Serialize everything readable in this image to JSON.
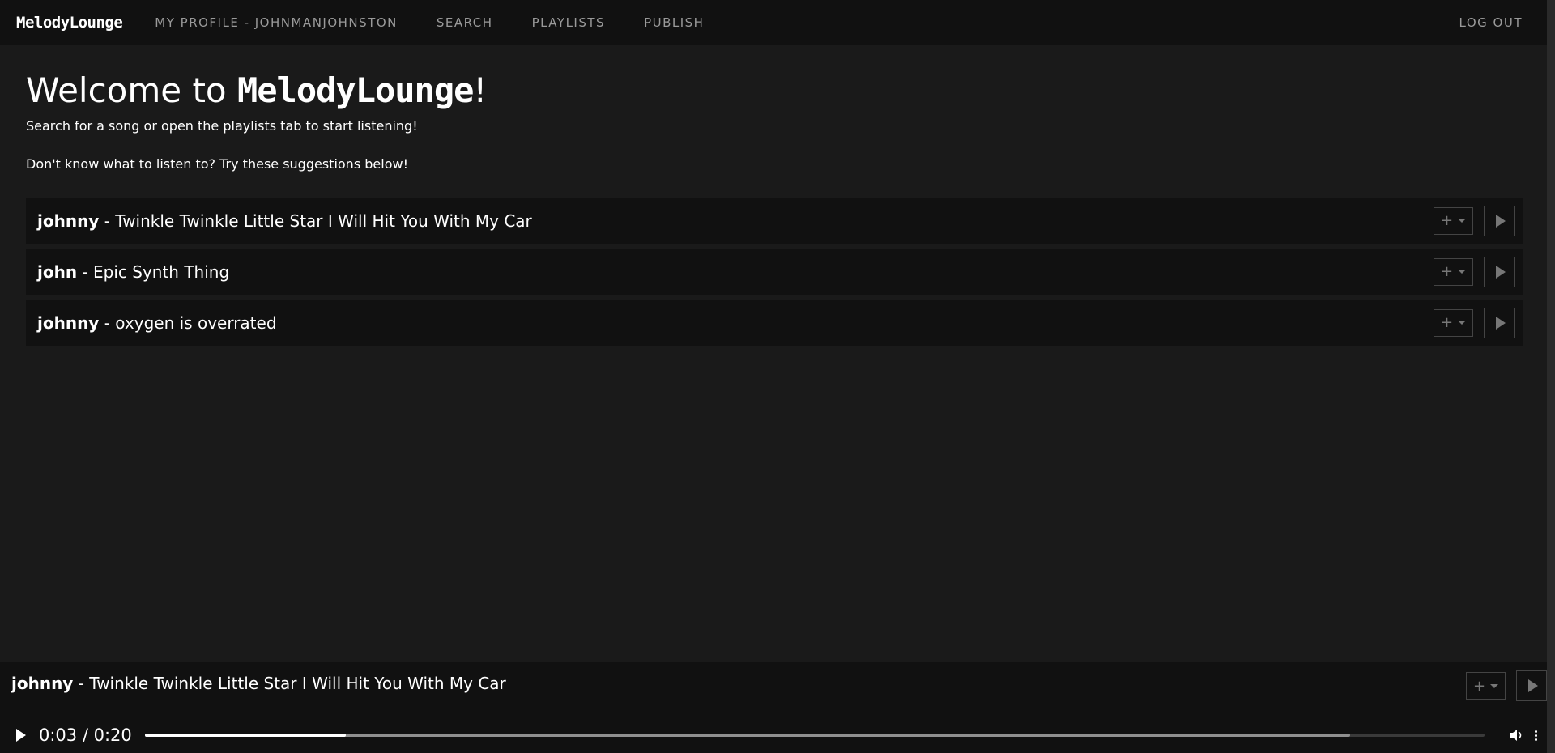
{
  "nav": {
    "brand": "MelodyLounge",
    "profile": "My Profile - johnmanjohnston",
    "search": "Search",
    "playlists": "Playlists",
    "publish": "Publish",
    "logout": "Log Out"
  },
  "main": {
    "welcome_prefix": "Welcome to ",
    "welcome_brand": "MelodyLounge",
    "welcome_suffix": "!",
    "subtitle": "Search for a song or open the playlists tab to start listening!",
    "suggestion_prompt": "Don't know what to listen to? Try these suggestions below!"
  },
  "songs": [
    {
      "artist": "johnny",
      "title": "Twinkle Twinkle Little Star I Will Hit You With My Car"
    },
    {
      "artist": "john",
      "title": "Epic Synth Thing"
    },
    {
      "artist": "johnny",
      "title": "oxygen is overrated"
    }
  ],
  "player": {
    "artist": "johnny",
    "title": "Twinkle Twinkle Little Star I Will Hit You With My Car",
    "current_time": "0:03",
    "duration": "0:20",
    "time_display": "0:03 / 0:20",
    "progress": 0.15,
    "buffered": 0.9
  },
  "icons": {
    "add": "plus-icon",
    "dropdown": "caret-down-icon",
    "play": "play-icon",
    "volume": "volume-icon",
    "more": "more-vertical-icon"
  },
  "colors": {
    "background": "#1a1a1a",
    "navbar": "#111111",
    "row": "#111111",
    "text": "#ffffff",
    "muted": "#9a9a9a"
  }
}
